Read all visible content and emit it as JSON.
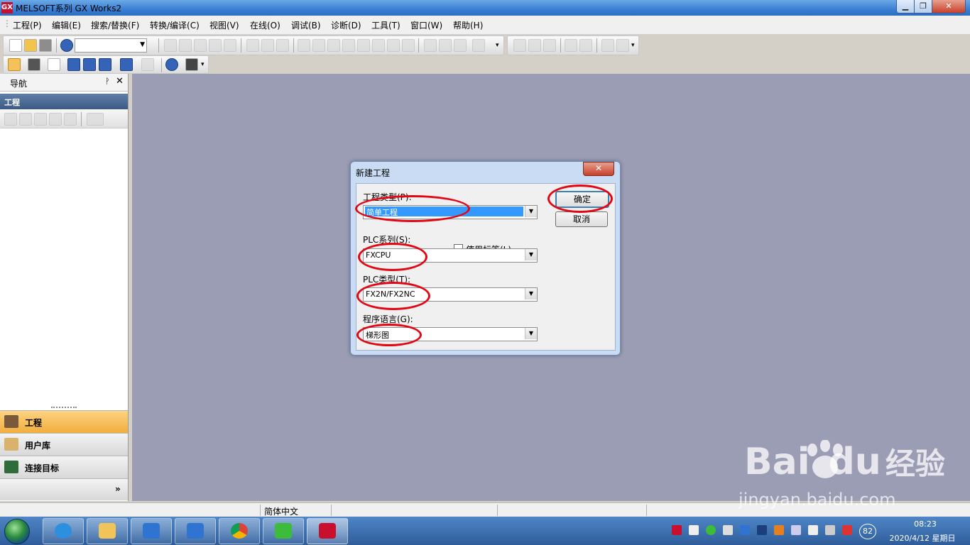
{
  "window": {
    "title": "MELSOFT系列 GX Works2",
    "logo": "GX"
  },
  "menu": [
    "工程(P)",
    "编辑(E)",
    "搜索/替换(F)",
    "转换/编译(C)",
    "视图(V)",
    "在线(O)",
    "调试(B)",
    "诊断(D)",
    "工具(T)",
    "窗口(W)",
    "帮助(H)"
  ],
  "nav": {
    "title": "导航",
    "pin": "ᚹ",
    "close": "✕",
    "sub_label": "工程",
    "more": "»",
    "buttons": [
      {
        "label": "工程",
        "active": true
      },
      {
        "label": "用户库",
        "active": false
      },
      {
        "label": "连接目标",
        "active": false
      }
    ]
  },
  "dialog": {
    "title": "新建工程",
    "close": "✕",
    "project_type_label": "工程类型(P):",
    "project_type_value": "简单工程",
    "use_label_checkbox": "使用标签(L)",
    "use_label_checked": false,
    "plc_series_label": "PLC系列(S):",
    "plc_series_value": "FXCPU",
    "plc_type_label": "PLC类型(T):",
    "plc_type_value": "FX2N/FX2NC",
    "program_language_label": "程序语言(G):",
    "program_language_value": "梯形图",
    "ok_button": "确定",
    "cancel_button": "取消"
  },
  "status": {
    "language": "简体中文"
  },
  "taskbar": {
    "time": "08:23",
    "date": "2020/4/12 星期日",
    "battery": "82"
  },
  "watermark": {
    "brand": "Bai",
    "brand2": "du",
    "brand3": "经验",
    "url": "jingyan.baidu.com"
  },
  "colors": {
    "workspace": "#9b9db5",
    "annotation": "#e30613",
    "selection": "#3399ff",
    "active_nav": "#f1ae3e"
  }
}
